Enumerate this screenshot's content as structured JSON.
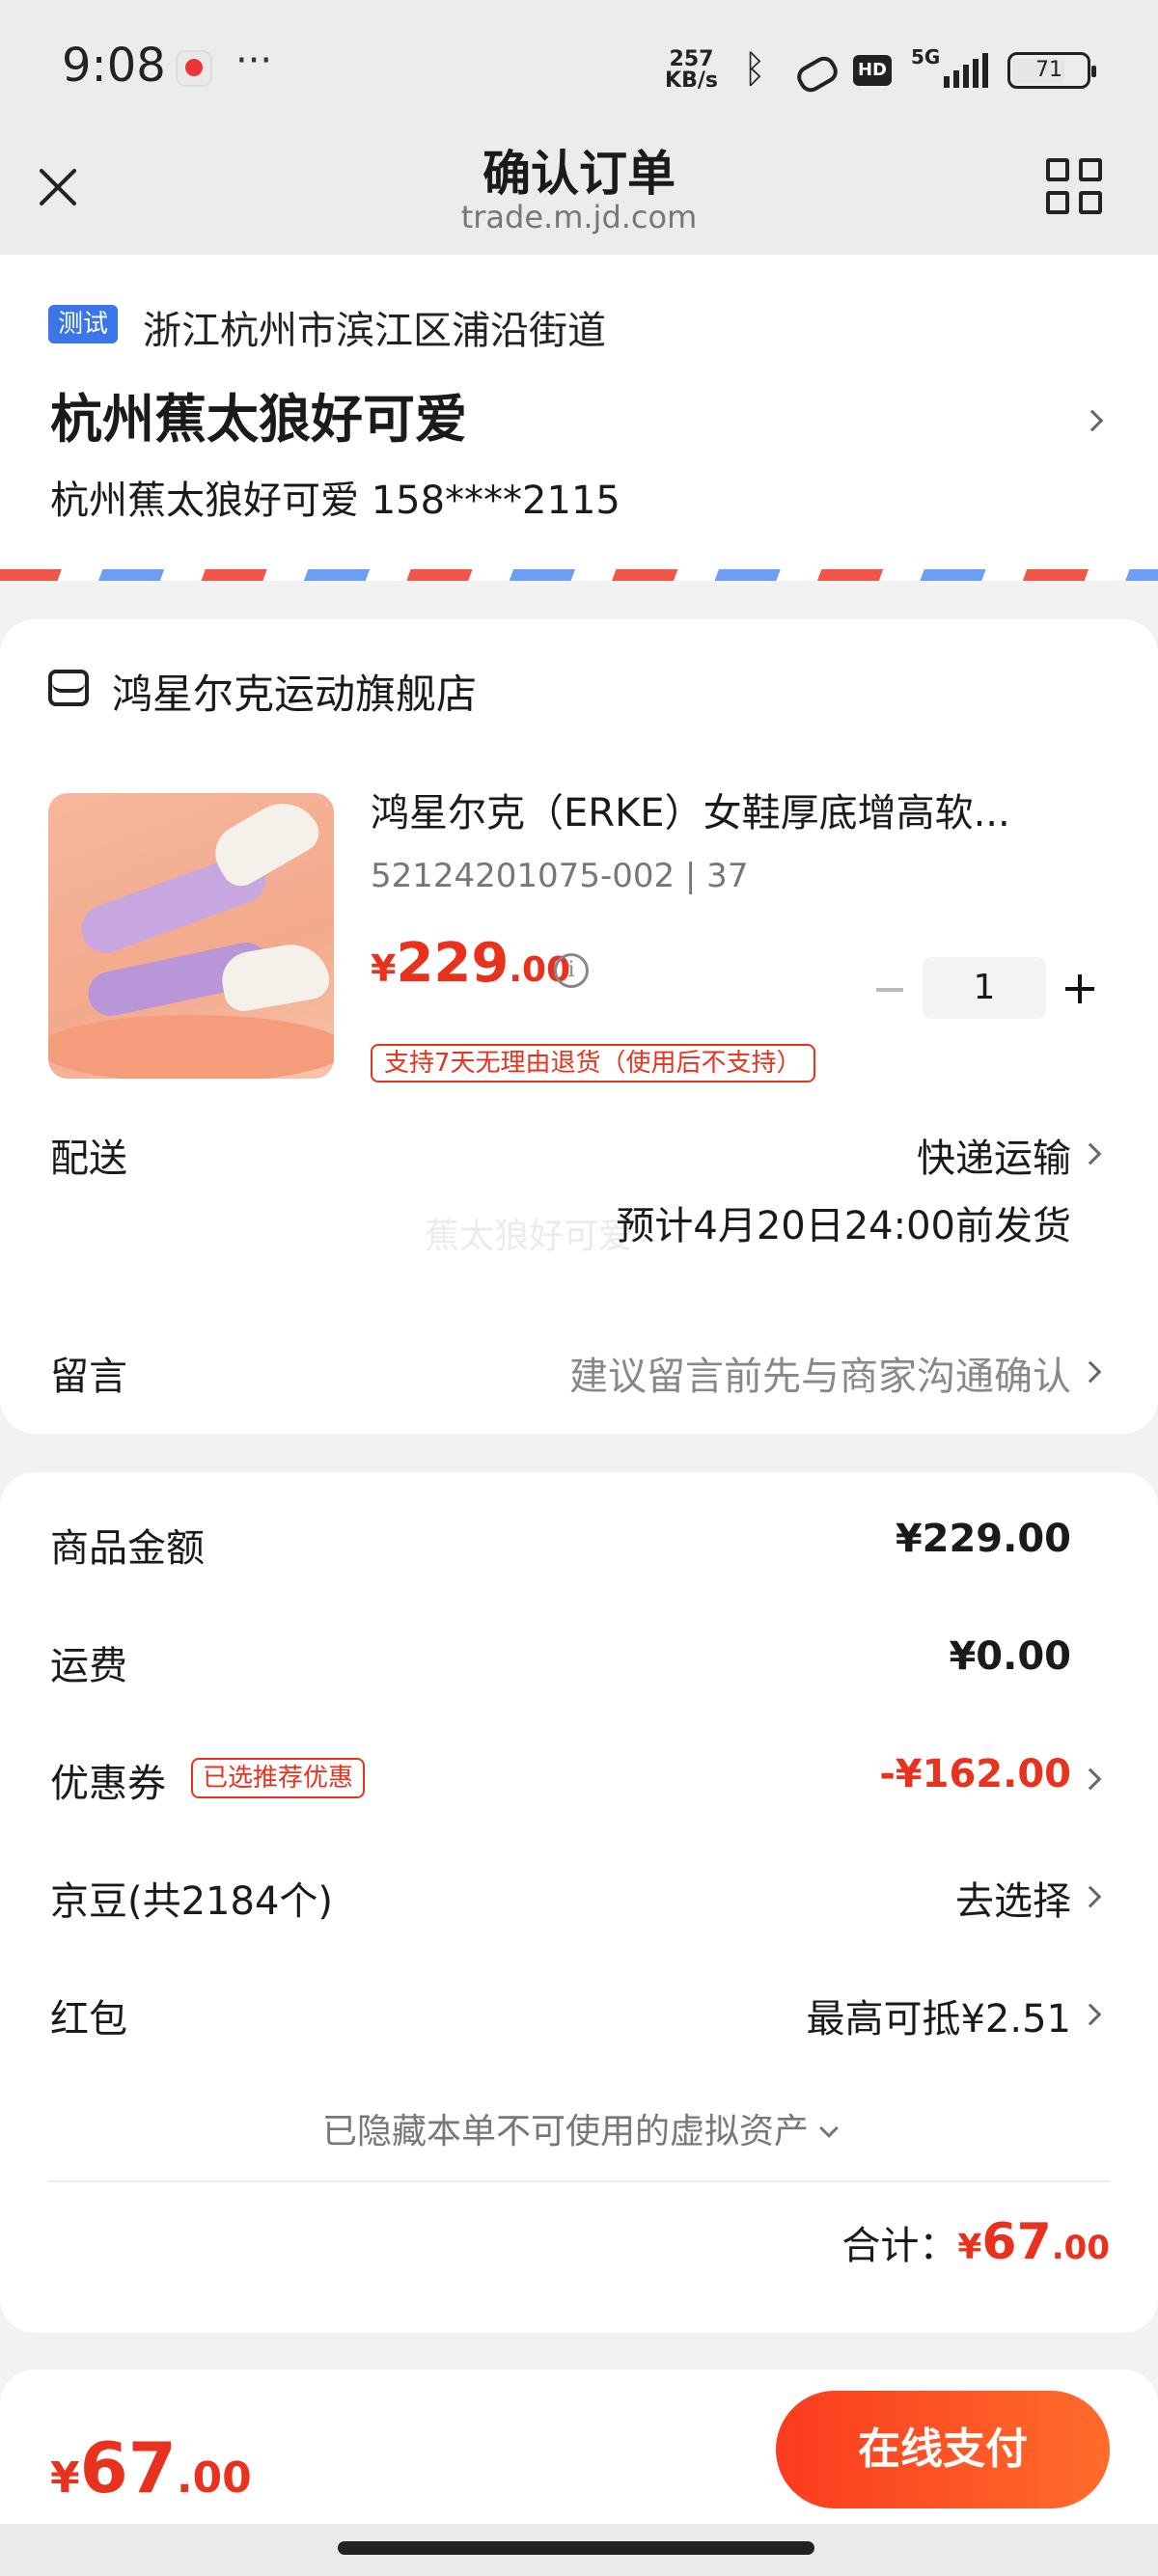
{
  "status_bar": {
    "time": "9:08",
    "more": "···",
    "net_speed_value": "257",
    "net_speed_unit": "KB/s",
    "hd": "HD",
    "network": "5G",
    "battery": "71",
    "battery_level": 0.71
  },
  "nav": {
    "title": "确认订单",
    "subtitle": "trade.m.jd.com"
  },
  "address": {
    "tag": "测试",
    "region": "浙江杭州市滨江区浦沿街道",
    "name": "杭州蕉太狼好可爱",
    "contact": "杭州蕉太狼好可爱 158****2115"
  },
  "store": {
    "name": "鸿星尔克运动旗舰店",
    "product": {
      "title": "鸿星尔克（ERKE）女鞋厚底增高软...",
      "spec": "52124201075-002 | 37",
      "price_currency": "¥",
      "price_int": "229",
      "price_dec": ".00",
      "quantity": "1",
      "return_policy": "支持7天无理由退货（使用后不支持）"
    },
    "delivery": {
      "label": "配送",
      "method": "快递运输",
      "estimate": "预计4月20日24:00前发货"
    },
    "watermark": "蕉太狼好可爱",
    "message": {
      "label": "留言",
      "placeholder": "建议留言前先与商家沟通确认"
    }
  },
  "summary": {
    "goods_amount": {
      "label": "商品金额",
      "value": "¥229.00"
    },
    "shipping": {
      "label": "运费",
      "value": "¥0.00"
    },
    "coupon": {
      "label": "优惠券",
      "tag": "已选推荐优惠",
      "value": "-¥162.00"
    },
    "jingdou": {
      "label": "京豆(共2184个)",
      "value": "去选择"
    },
    "redpacket": {
      "label": "红包",
      "value": "最高可抵¥2.51"
    },
    "hidden_assets": "已隐藏本单不可使用的虚拟资产",
    "total_label": "合计：",
    "total_currency": "¥",
    "total_int": "67",
    "total_dec": ".00"
  },
  "bottom": {
    "price_currency": "¥",
    "price_int": "67",
    "price_dec": ".00",
    "pay_label": "在线支付"
  },
  "colors": {
    "accent_red": "#e8321e",
    "tag_blue": "#3b76e8"
  }
}
